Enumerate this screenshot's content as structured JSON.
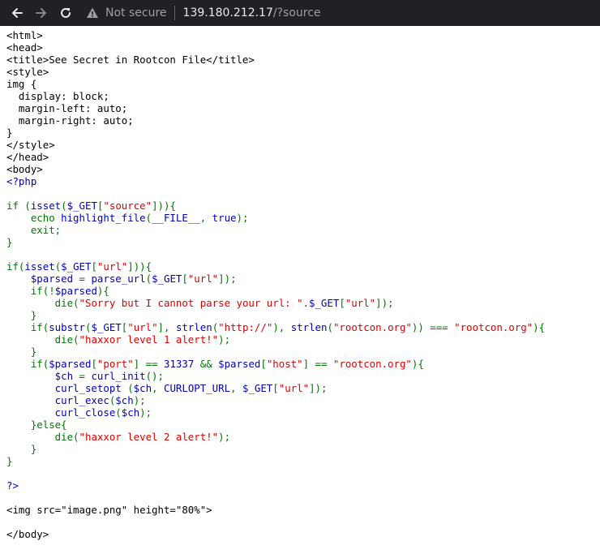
{
  "browser": {
    "security_label": "Not secure",
    "url_host": "139.180.212.17",
    "url_path": "/?source",
    "icons": {
      "back": "arrow-left-icon",
      "forward": "arrow-right-icon",
      "reload": "reload-icon",
      "security": "warning-triangle-icon"
    }
  },
  "highlight_colors": {
    "html": "#000000",
    "default": "#0000BB",
    "keyword": "#007700",
    "string": "#DD0000"
  },
  "source_lines": [
    [
      [
        "html",
        "<html>"
      ]
    ],
    [
      [
        "html",
        "<head>"
      ]
    ],
    [
      [
        "html",
        "<title>See Secret in Rootcon File</title>"
      ]
    ],
    [
      [
        "html",
        "<style>"
      ]
    ],
    [
      [
        "html",
        "img {"
      ]
    ],
    [
      [
        "html",
        "  display: block;"
      ]
    ],
    [
      [
        "html",
        "  margin-left: auto;"
      ]
    ],
    [
      [
        "html",
        "  margin-right: auto;"
      ]
    ],
    [
      [
        "html",
        "}"
      ]
    ],
    [
      [
        "html",
        "</style>"
      ]
    ],
    [
      [
        "html",
        "</head>"
      ]
    ],
    [
      [
        "html",
        "<body>"
      ]
    ],
    [
      [
        "default",
        "<?php"
      ]
    ],
    [],
    [
      [
        "keyword",
        "if ("
      ],
      [
        "default",
        "isset"
      ],
      [
        "keyword",
        "("
      ],
      [
        "default",
        "$_GET"
      ],
      [
        "keyword",
        "["
      ],
      [
        "string",
        "\"source\""
      ],
      [
        "keyword",
        "])){"
      ]
    ],
    [
      [
        "keyword",
        "    echo "
      ],
      [
        "default",
        "highlight_file"
      ],
      [
        "keyword",
        "("
      ],
      [
        "default",
        "__FILE__"
      ],
      [
        "keyword",
        ", "
      ],
      [
        "default",
        "true"
      ],
      [
        "keyword",
        ");"
      ]
    ],
    [
      [
        "keyword",
        "    exit;"
      ]
    ],
    [
      [
        "keyword",
        "}"
      ]
    ],
    [],
    [
      [
        "keyword",
        "if("
      ],
      [
        "default",
        "isset"
      ],
      [
        "keyword",
        "("
      ],
      [
        "default",
        "$_GET"
      ],
      [
        "keyword",
        "["
      ],
      [
        "string",
        "\"url\""
      ],
      [
        "keyword",
        "])){"
      ]
    ],
    [
      [
        "default",
        "    $parsed "
      ],
      [
        "keyword",
        "= "
      ],
      [
        "default",
        "parse_url"
      ],
      [
        "keyword",
        "("
      ],
      [
        "default",
        "$_GET"
      ],
      [
        "keyword",
        "["
      ],
      [
        "string",
        "\"url\""
      ],
      [
        "keyword",
        "]);"
      ]
    ],
    [
      [
        "keyword",
        "    if(!"
      ],
      [
        "default",
        "$parsed"
      ],
      [
        "keyword",
        "){"
      ]
    ],
    [
      [
        "keyword",
        "        die("
      ],
      [
        "string",
        "\"Sorry but I cannot parse your url: \""
      ],
      [
        "keyword",
        "."
      ],
      [
        "default",
        "$_GET"
      ],
      [
        "keyword",
        "["
      ],
      [
        "string",
        "\"url\""
      ],
      [
        "keyword",
        "]);"
      ]
    ],
    [
      [
        "keyword",
        "    }"
      ]
    ],
    [
      [
        "keyword",
        "    if("
      ],
      [
        "default",
        "substr"
      ],
      [
        "keyword",
        "("
      ],
      [
        "default",
        "$_GET"
      ],
      [
        "keyword",
        "["
      ],
      [
        "string",
        "\"url\""
      ],
      [
        "keyword",
        "], "
      ],
      [
        "default",
        "strlen"
      ],
      [
        "keyword",
        "("
      ],
      [
        "string",
        "\"http://\""
      ],
      [
        "keyword",
        "), "
      ],
      [
        "default",
        "strlen"
      ],
      [
        "keyword",
        "("
      ],
      [
        "string",
        "\"rootcon.org\""
      ],
      [
        "keyword",
        ")) === "
      ],
      [
        "string",
        "\"rootcon.org\""
      ],
      [
        "keyword",
        "){"
      ]
    ],
    [
      [
        "keyword",
        "        die("
      ],
      [
        "string",
        "\"haxxor level 1 alert!\""
      ],
      [
        "keyword",
        ");"
      ]
    ],
    [
      [
        "keyword",
        "    }"
      ]
    ],
    [
      [
        "keyword",
        "    if("
      ],
      [
        "default",
        "$parsed"
      ],
      [
        "keyword",
        "["
      ],
      [
        "string",
        "\"port\""
      ],
      [
        "keyword",
        "] == "
      ],
      [
        "default",
        "31337 "
      ],
      [
        "keyword",
        "&& "
      ],
      [
        "default",
        "$parsed"
      ],
      [
        "keyword",
        "["
      ],
      [
        "string",
        "\"host\""
      ],
      [
        "keyword",
        "] == "
      ],
      [
        "string",
        "\"rootcon.org\""
      ],
      [
        "keyword",
        "){"
      ]
    ],
    [
      [
        "default",
        "        $ch "
      ],
      [
        "keyword",
        "= "
      ],
      [
        "default",
        "curl_init"
      ],
      [
        "keyword",
        "();"
      ]
    ],
    [
      [
        "default",
        "        curl_setopt "
      ],
      [
        "keyword",
        "("
      ],
      [
        "default",
        "$ch"
      ],
      [
        "keyword",
        ", "
      ],
      [
        "default",
        "CURLOPT_URL"
      ],
      [
        "keyword",
        ", "
      ],
      [
        "default",
        "$_GET"
      ],
      [
        "keyword",
        "["
      ],
      [
        "string",
        "\"url\""
      ],
      [
        "keyword",
        "]);"
      ]
    ],
    [
      [
        "default",
        "        curl_exec"
      ],
      [
        "keyword",
        "("
      ],
      [
        "default",
        "$ch"
      ],
      [
        "keyword",
        ");"
      ]
    ],
    [
      [
        "default",
        "        curl_close"
      ],
      [
        "keyword",
        "("
      ],
      [
        "default",
        "$ch"
      ],
      [
        "keyword",
        ");"
      ]
    ],
    [
      [
        "keyword",
        "    }else{"
      ]
    ],
    [
      [
        "keyword",
        "        die("
      ],
      [
        "string",
        "\"haxxor level 2 alert!\""
      ],
      [
        "keyword",
        ");"
      ]
    ],
    [
      [
        "keyword",
        "    }"
      ]
    ],
    [
      [
        "keyword",
        "}"
      ]
    ],
    [],
    [
      [
        "default",
        "?>"
      ]
    ],
    [],
    [
      [
        "html",
        "<img src=\"image.png\" height=\"80%\">"
      ]
    ],
    [],
    [
      [
        "html",
        "</body>"
      ]
    ]
  ]
}
